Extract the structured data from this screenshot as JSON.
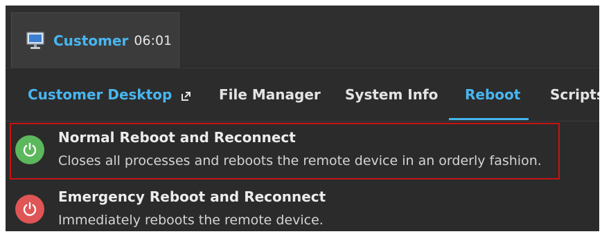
{
  "session": {
    "name": "Customer",
    "time": "06:01",
    "icon": "monitor-icon"
  },
  "nav": {
    "items": [
      {
        "label": "Customer Desktop",
        "icon": "external-link-icon"
      },
      {
        "label": "File Manager"
      },
      {
        "label": "System Info"
      },
      {
        "label": "Reboot",
        "active": true
      },
      {
        "label": "Scripts"
      }
    ]
  },
  "options": [
    {
      "title": "Normal Reboot and Reconnect",
      "description": "Closes all processes and reboots the remote device in an orderly fashion.",
      "icon": "power-icon",
      "color": "#5cb85c",
      "highlighted": true
    },
    {
      "title": "Emergency Reboot and Reconnect",
      "description": "Immediately reboots the remote device.",
      "icon": "power-icon",
      "color": "#e05555"
    }
  ],
  "colors": {
    "accent": "#48b6f0",
    "background": "#2b2b2b",
    "highlight": "#c81414"
  }
}
